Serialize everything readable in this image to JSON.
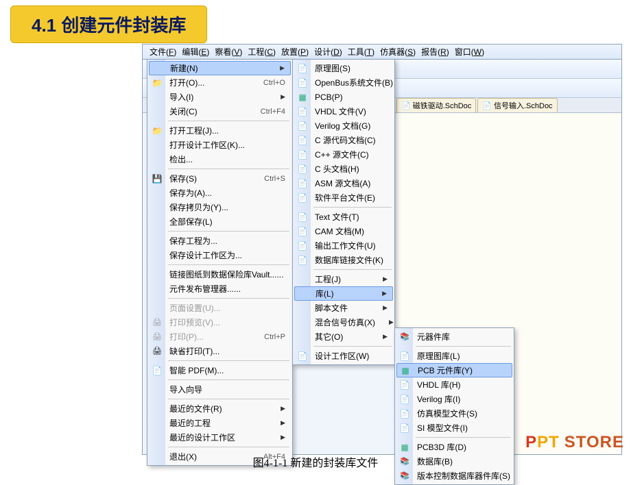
{
  "slide_title": "4.1  创建元件封装库",
  "caption": "图4-1-1  新建的封装库文件",
  "watermark": "PPT STORE",
  "menubar": [
    {
      "label": "文件",
      "key": "F"
    },
    {
      "label": "编辑",
      "key": "E"
    },
    {
      "label": "察看",
      "key": "V"
    },
    {
      "label": "工程",
      "key": "C"
    },
    {
      "label": "放置",
      "key": "P"
    },
    {
      "label": "设计",
      "key": "D"
    },
    {
      "label": "工具",
      "key": "T"
    },
    {
      "label": "仿真器",
      "key": "S"
    },
    {
      "label": "报告",
      "key": "R"
    },
    {
      "label": "窗口",
      "key": "W"
    }
  ],
  "tabs": [
    {
      "label": "磁铁驱动.SchDoc"
    },
    {
      "label": "信号输入.SchDoc"
    }
  ],
  "menu1": [
    {
      "label": "新建(N)",
      "type": "sub",
      "highlight": true,
      "icon": ""
    },
    {
      "label": "打开(O)...",
      "shortcut": "Ctrl+O",
      "icon": "folder"
    },
    {
      "label": "导入(I)",
      "type": "sub"
    },
    {
      "label": "关闭(C)",
      "shortcut": "Ctrl+F4"
    },
    {
      "type": "sep"
    },
    {
      "label": "打开工程(J)...",
      "icon": "folder"
    },
    {
      "label": "打开设计工作区(K)..."
    },
    {
      "label": "检出..."
    },
    {
      "type": "sep"
    },
    {
      "label": "保存(S)",
      "shortcut": "Ctrl+S",
      "icon": "save"
    },
    {
      "label": "保存为(A)..."
    },
    {
      "label": "保存拷贝为(Y)..."
    },
    {
      "label": "全部保存(L)"
    },
    {
      "type": "sep"
    },
    {
      "label": "保存工程为..."
    },
    {
      "label": "保存设计工作区为..."
    },
    {
      "type": "sep"
    },
    {
      "label": "链接图纸到数据保险库Vault......"
    },
    {
      "label": "元件发布管理器......"
    },
    {
      "type": "sep"
    },
    {
      "label": "页面设置(U)...",
      "disabled": true
    },
    {
      "label": "打印预览(V)...",
      "disabled": true,
      "icon": "print"
    },
    {
      "label": "打印(P)...",
      "shortcut": "Ctrl+P",
      "disabled": true,
      "icon": "print"
    },
    {
      "label": "缺省打印(T)...",
      "icon": "print"
    },
    {
      "type": "sep"
    },
    {
      "label": "智能 PDF(M)...",
      "icon": "pdf"
    },
    {
      "type": "sep"
    },
    {
      "label": "导入向导"
    },
    {
      "type": "sep"
    },
    {
      "label": "最近的文件(R)",
      "type": "sub"
    },
    {
      "label": "最近的工程",
      "type": "sub"
    },
    {
      "label": "最近的设计工作区",
      "type": "sub"
    },
    {
      "type": "sep"
    },
    {
      "label": "退出(X)",
      "shortcut": "Alt+F4"
    }
  ],
  "menu2": [
    {
      "label": "原理图(S)",
      "icon": "doc"
    },
    {
      "label": "OpenBus系统文件(B)",
      "icon": "doc"
    },
    {
      "label": "PCB(P)",
      "icon": "pcb"
    },
    {
      "label": "VHDL 文件(V)",
      "icon": "doc"
    },
    {
      "label": "Verilog 文档(G)",
      "icon": "doc"
    },
    {
      "label": "C 源代码文档(C)",
      "icon": "doc"
    },
    {
      "label": "C++ 源文件(C)",
      "icon": "doc"
    },
    {
      "label": "C 头文档(H)",
      "icon": "doc"
    },
    {
      "label": "ASM 源文档(A)",
      "icon": "doc"
    },
    {
      "label": "软件平台文件(E)",
      "icon": "doc"
    },
    {
      "type": "sep"
    },
    {
      "label": "Text  文件(T)",
      "icon": "doc"
    },
    {
      "label": "CAM 文档(M)",
      "icon": "doc"
    },
    {
      "label": "输出工作文件(U)",
      "icon": "doc"
    },
    {
      "label": "数据库链接文件(K)",
      "icon": "doc"
    },
    {
      "type": "sep"
    },
    {
      "label": "工程(J)",
      "type": "sub"
    },
    {
      "label": "库(L)",
      "type": "sub",
      "highlight": true
    },
    {
      "label": "脚本文件",
      "type": "sub"
    },
    {
      "label": "混合信号仿真(X)",
      "type": "sub"
    },
    {
      "label": "其它(O)",
      "type": "sub"
    },
    {
      "type": "sep"
    },
    {
      "label": "设计工作区(W)",
      "icon": "doc"
    }
  ],
  "menu3": [
    {
      "label": "元器件库",
      "icon": "lib"
    },
    {
      "type": "sep"
    },
    {
      "label": "原理图库(L)",
      "icon": "doc"
    },
    {
      "label": "PCB 元件库(Y)",
      "highlight": true,
      "icon": "pcb"
    },
    {
      "label": "VHDL 库(H)",
      "icon": "doc"
    },
    {
      "label": "Verilog 库(I)",
      "icon": "doc"
    },
    {
      "label": "仿真模型文件(S)",
      "icon": "doc"
    },
    {
      "label": "SI 模型文件(I)",
      "icon": "doc"
    },
    {
      "type": "sep"
    },
    {
      "label": "PCB3D 库(D)",
      "icon": "pcb"
    },
    {
      "label": "数据库(B)",
      "icon": "lib"
    },
    {
      "label": "版本控制数据库器件库(S)",
      "icon": "lib"
    }
  ]
}
